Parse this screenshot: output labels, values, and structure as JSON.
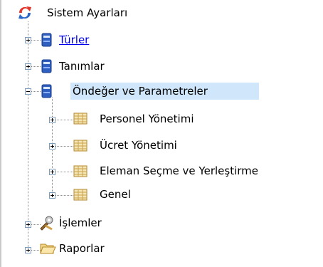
{
  "tree": {
    "root": {
      "label": "Sistem Ayarları",
      "icon": "sync-arrows-icon"
    },
    "items": [
      {
        "label": "Türler",
        "icon": "book-icon",
        "expander": "plus",
        "style": "link"
      },
      {
        "label": "Tanımlar",
        "icon": "book-icon",
        "expander": "plus"
      },
      {
        "label": "Öndeğer ve Parametreler",
        "icon": "book-icon",
        "expander": "minus",
        "selected": true,
        "children": [
          {
            "label": "Personel Yönetimi",
            "icon": "grid-icon",
            "expander": "plus"
          },
          {
            "label": "Ücret Yönetimi",
            "icon": "grid-icon",
            "expander": "plus"
          },
          {
            "label": "Eleman Seçme ve Yerleştirme",
            "icon": "grid-icon",
            "expander": "plus"
          },
          {
            "label": "Genel",
            "icon": "grid-icon",
            "expander": "plus"
          }
        ]
      },
      {
        "label": "İşlemler",
        "icon": "tools-icon",
        "expander": "plus"
      },
      {
        "label": "Raporlar",
        "icon": "folder-icon",
        "expander": "plus"
      }
    ]
  },
  "colors": {
    "selection": "#cfe6fb",
    "link": "#0000ee",
    "book_blue": "#2f5fbf",
    "grid_gold": "#d7b55a"
  }
}
